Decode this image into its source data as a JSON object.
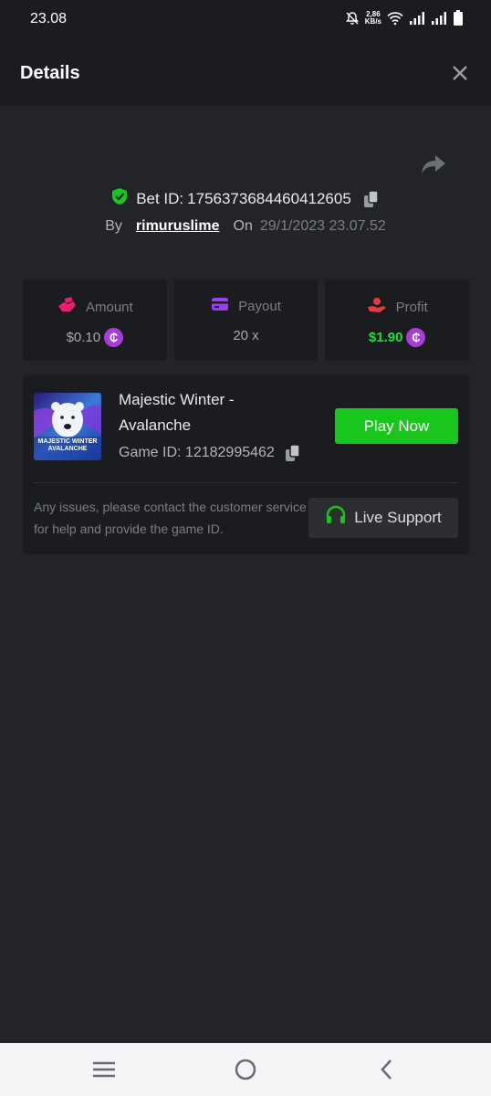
{
  "status_bar": {
    "time": "23.08",
    "net_speed_value": "2,86",
    "net_speed_unit": "KB/s"
  },
  "header": {
    "title": "Details"
  },
  "bet": {
    "label": "Bet ID:",
    "id": "1756373684460412605",
    "by_label": "By",
    "username": "rimuruslime",
    "on_label": "On",
    "datetime": "29/1/2023 23.07.52"
  },
  "stats": {
    "amount": {
      "label": "Amount",
      "value": "$0.10",
      "icon_color": "#e8206f"
    },
    "payout": {
      "label": "Payout",
      "value": "20 x",
      "icon_color": "#9b3df0"
    },
    "profit": {
      "label": "Profit",
      "value": "$1.90",
      "icon_color": "#e83a3a",
      "value_color": "#19e23a"
    },
    "coin_symbol": "₵"
  },
  "game": {
    "name": "Majestic Winter - Avalanche",
    "thumb_line1": "MAJESTIC WINTER",
    "thumb_line2": "AVALANCHE",
    "id_label": "Game ID:",
    "id": "12182995462",
    "play_label": "Play Now",
    "notice": "Any issues, please contact the customer service for help and provide the game ID.",
    "support_label": "Live Support"
  },
  "colors": {
    "accent_green": "#19c61c",
    "background": "#232428",
    "card": "#1b1c1f"
  }
}
